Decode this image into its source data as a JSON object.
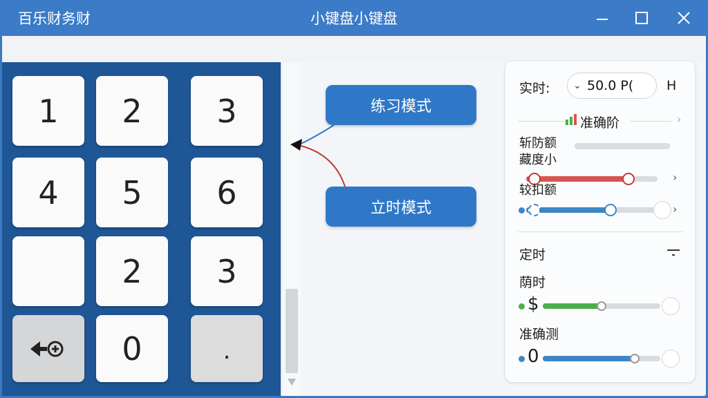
{
  "window": {
    "app_name": "百乐财务财",
    "title": "小键盘小键盘"
  },
  "keypad": {
    "keys": [
      {
        "label": "1"
      },
      {
        "label": "2"
      },
      {
        "label": "3"
      },
      {
        "label": "4"
      },
      {
        "label": "5"
      },
      {
        "label": "6"
      },
      {
        "label": ""
      },
      {
        "label": "2"
      },
      {
        "label": "3"
      },
      {
        "label": "backspace"
      },
      {
        "label": "0"
      },
      {
        "label": "."
      }
    ]
  },
  "modes": {
    "practice": "练习模式",
    "realtime": "立时模式"
  },
  "panel": {
    "realtime_label": "实时:",
    "realtime_value": "50.0 P(",
    "realtime_suffix": "H",
    "accuracy_section": "准确阶",
    "line1": "斩防额",
    "line2": "藏度小",
    "line3": "较扣额",
    "timer_label": "定时",
    "time_label": "荫时",
    "speed_value": 0.5,
    "accuracy_label": "准确测",
    "accuracy_value": 0.78,
    "top_red_value": 0.78,
    "top_blue_value": 0.64,
    "colors": {
      "accent_blue": "#2f78c8",
      "red": "#d9534f",
      "green": "#4cae4c",
      "steel_blue": "#3d86c6"
    }
  }
}
